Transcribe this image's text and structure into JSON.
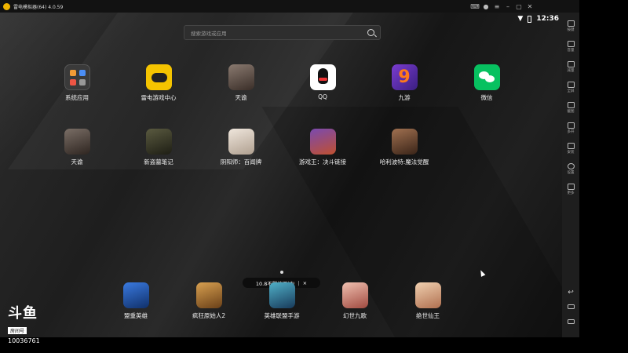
{
  "window": {
    "title": "雷电模拟器(64) 4.0.59"
  },
  "status": {
    "time": "12:36"
  },
  "search": {
    "placeholder": "搜索游戏或应用"
  },
  "apps_row1": [
    {
      "label": "系统应用",
      "icon": "system-apps-folder-icon",
      "color": "#3a3a3a"
    },
    {
      "label": "雷电游戏中心",
      "icon": "gamepad-icon",
      "color": "#f5c400"
    },
    {
      "label": "天谕",
      "icon": "tianyu-game-icon",
      "color": "#5a4a40"
    },
    {
      "label": "QQ",
      "icon": "qq-penguin-icon",
      "color": "#ffffff"
    },
    {
      "label": "九游",
      "icon": "jiuyou-icon",
      "color": "#5b2ea6"
    },
    {
      "label": "微信",
      "icon": "wechat-icon",
      "color": "#07c160"
    }
  ],
  "apps_row2": [
    {
      "label": "天谕",
      "icon": "tianyu-game-icon",
      "color": "#5a4a40"
    },
    {
      "label": "新盗墓笔记",
      "icon": "daomu-game-icon",
      "color": "#3a3a2a"
    },
    {
      "label": "阴阳师：百闻牌",
      "icon": "onmyoji-card-icon",
      "color": "#d9cfc6"
    },
    {
      "label": "游戏王：决斗链接",
      "icon": "yugioh-icon",
      "color": "#4a3a6a"
    },
    {
      "label": "哈利波特:魔法觉醒",
      "icon": "harry-potter-icon",
      "color": "#6a4a30"
    }
  ],
  "dock": [
    {
      "label": "盟重英雄",
      "icon": "mengzhong-hero-icon",
      "color": "#1f4fb5"
    },
    {
      "label": "疯狂原始人2",
      "icon": "croods-icon",
      "color": "#b57a2a"
    },
    {
      "label": "英雄联盟手游",
      "icon": "lol-mobile-icon",
      "color": "#2a7a9a"
    },
    {
      "label": "幻世九歌",
      "icon": "huanshi-jiuge-icon",
      "color": "#c98a7a"
    },
    {
      "label": "绝世仙王",
      "icon": "jueshi-xianwang-icon",
      "color": "#d9a07a"
    }
  ],
  "toast": {
    "text": "10.8不删档测试!",
    "close": "×"
  },
  "sidebar": [
    {
      "label": "按键",
      "icon": "keyboard-icon"
    },
    {
      "label": "音量",
      "icon": "volume-up-icon"
    },
    {
      "label": "减量",
      "icon": "volume-down-icon"
    },
    {
      "label": "全屏",
      "icon": "fullscreen-icon"
    },
    {
      "label": "截图",
      "icon": "scissors-icon"
    },
    {
      "label": "多开",
      "icon": "multi-instance-icon"
    },
    {
      "label": "安装",
      "icon": "install-apk-icon"
    },
    {
      "label": "设置",
      "icon": "settings-gear-icon"
    },
    {
      "label": "更多",
      "icon": "more-icon"
    }
  ],
  "watermark": {
    "brand": "斗鱼",
    "room": "房间号",
    "number": "10036761"
  }
}
